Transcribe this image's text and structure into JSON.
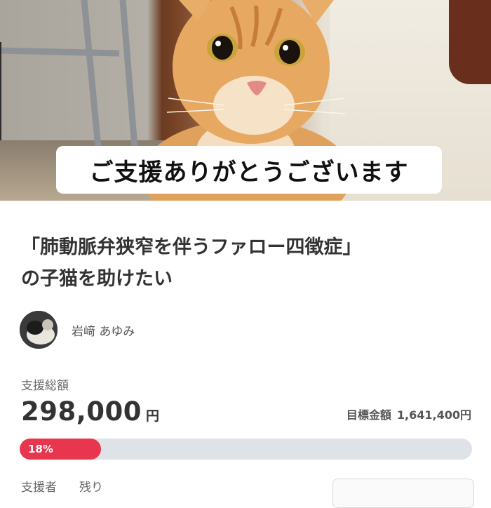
{
  "hero": {
    "caption": "ご支援ありがとうございます"
  },
  "project": {
    "title_line1": "「肺動脈弁狭窄を伴うファロー四徴症」",
    "title_line2": "の子猫を助けたい"
  },
  "author": {
    "name": "岩﨑 あゆみ"
  },
  "funding": {
    "total_label": "支援総額",
    "total_amount": "298,000",
    "currency": "円",
    "goal_label": "目標金額",
    "goal_amount": "1,641,400円",
    "progress_text": "18%",
    "progress_fraction": 0.18,
    "accent_color": "#e8364e"
  },
  "stats": {
    "supporters_label": "支援者",
    "remaining_label": "残り"
  }
}
